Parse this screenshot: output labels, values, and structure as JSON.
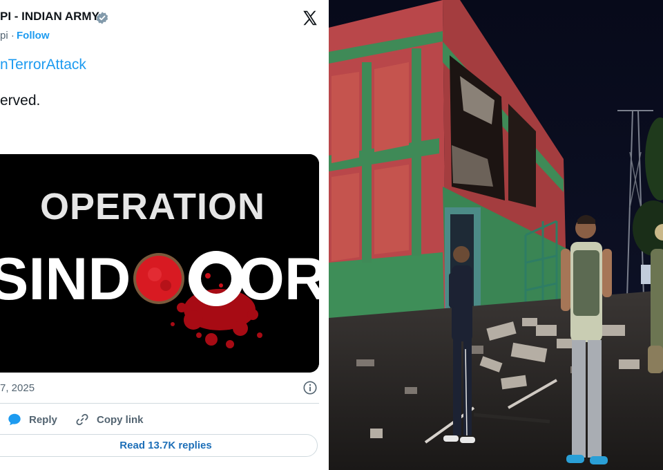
{
  "tweet": {
    "account_name": "PI - INDIAN ARMY",
    "handle": "pi ·",
    "follow_label": "Follow",
    "hashtag": "nTerrorAttack",
    "body_text": "erved.",
    "media_title_line1": "OPERATION",
    "media_title_line2_left": "SIND",
    "media_title_line2_right": "OR",
    "date": "7, 2025",
    "reply_label": "Reply",
    "copy_link_label": "Copy link",
    "read_replies_label": "Read 13.7K replies"
  },
  "colors": {
    "link_blue": "#1d9bf0",
    "text_dark": "#0f1419",
    "text_muted": "#536471",
    "border": "#cfd9de",
    "sindoor_red": "#c8101a"
  },
  "icons": [
    "verified-badge-icon",
    "x-logo-icon",
    "info-icon",
    "reply-icon",
    "copy-link-icon"
  ]
}
